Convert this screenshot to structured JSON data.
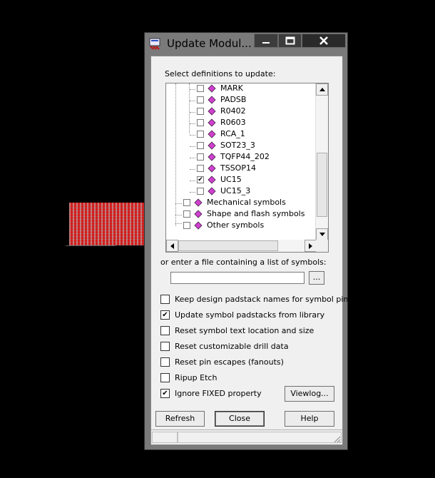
{
  "window": {
    "title": "Update Modul...",
    "controls": {
      "minimize": "minimize",
      "maximize": "maximize",
      "close": "close"
    }
  },
  "prompt_label": "Select definitions to update:",
  "tree": {
    "items": [
      {
        "label": "MARK",
        "checked": false
      },
      {
        "label": "PADSB",
        "checked": false
      },
      {
        "label": "R0402",
        "checked": false
      },
      {
        "label": "R0603",
        "checked": false
      },
      {
        "label": "RCA_1",
        "checked": false
      },
      {
        "label": "SOT23_3",
        "checked": false
      },
      {
        "label": "TQFP44_202",
        "checked": false
      },
      {
        "label": "TSSOP14",
        "checked": false
      },
      {
        "label": "UC15",
        "checked": true
      },
      {
        "label": "UC15_3",
        "checked": false
      }
    ],
    "groups": [
      {
        "label": "Mechanical symbols",
        "checked": false
      },
      {
        "label": "Shape and flash symbols",
        "checked": false
      },
      {
        "label": "Other symbols",
        "checked": false
      }
    ]
  },
  "file_label": "or enter a file containing a list of symbols:",
  "file_input": {
    "value": ""
  },
  "browse_label": "...",
  "options": [
    {
      "label": "Keep design padstack names for symbol pins",
      "checked": false
    },
    {
      "label": "Update symbol padstacks from library",
      "checked": true
    },
    {
      "label": "Reset symbol text location and size",
      "checked": false
    },
    {
      "label": "Reset customizable drill data",
      "checked": false
    },
    {
      "label": "Reset pin escapes (fanouts)",
      "checked": false
    },
    {
      "label": "Ripup Etch",
      "checked": false
    },
    {
      "label": "Ignore FIXED property",
      "checked": true
    }
  ],
  "buttons": {
    "viewlog": "Viewlog...",
    "refresh": "Refresh",
    "close": "Close",
    "help": "Help"
  },
  "colors": {
    "symbol_icon": "#d040d0",
    "canvas_art": "#d81818",
    "close_button": "#2a2a2a"
  }
}
